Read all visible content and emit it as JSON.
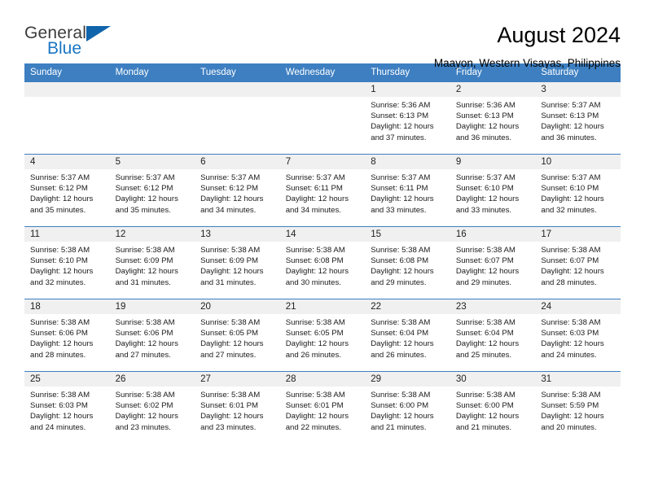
{
  "brand": {
    "line1": "General",
    "line2": "Blue",
    "triangle_color": "#1064ac",
    "blue_text_color": "#1b76c3"
  },
  "header": {
    "title": "August 2024",
    "subtitle": "Maayon, Western Visayas, Philippines"
  },
  "theme": {
    "header_row_bg": "#3d7fc1",
    "daynum_band_bg": "#f0f0f0",
    "row_divider": "#3d7fc1"
  },
  "calendar": {
    "weekday_headers": [
      "Sunday",
      "Monday",
      "Tuesday",
      "Wednesday",
      "Thursday",
      "Friday",
      "Saturday"
    ],
    "weeks": [
      [
        {
          "day": "",
          "sunrise": "",
          "sunset": "",
          "daylight": "",
          "daylight2": ""
        },
        {
          "day": "",
          "sunrise": "",
          "sunset": "",
          "daylight": "",
          "daylight2": ""
        },
        {
          "day": "",
          "sunrise": "",
          "sunset": "",
          "daylight": "",
          "daylight2": ""
        },
        {
          "day": "",
          "sunrise": "",
          "sunset": "",
          "daylight": "",
          "daylight2": ""
        },
        {
          "day": "1",
          "sunrise": "Sunrise: 5:36 AM",
          "sunset": "Sunset: 6:13 PM",
          "daylight": "Daylight: 12 hours",
          "daylight2": "and 37 minutes."
        },
        {
          "day": "2",
          "sunrise": "Sunrise: 5:36 AM",
          "sunset": "Sunset: 6:13 PM",
          "daylight": "Daylight: 12 hours",
          "daylight2": "and 36 minutes."
        },
        {
          "day": "3",
          "sunrise": "Sunrise: 5:37 AM",
          "sunset": "Sunset: 6:13 PM",
          "daylight": "Daylight: 12 hours",
          "daylight2": "and 36 minutes."
        }
      ],
      [
        {
          "day": "4",
          "sunrise": "Sunrise: 5:37 AM",
          "sunset": "Sunset: 6:12 PM",
          "daylight": "Daylight: 12 hours",
          "daylight2": "and 35 minutes."
        },
        {
          "day": "5",
          "sunrise": "Sunrise: 5:37 AM",
          "sunset": "Sunset: 6:12 PM",
          "daylight": "Daylight: 12 hours",
          "daylight2": "and 35 minutes."
        },
        {
          "day": "6",
          "sunrise": "Sunrise: 5:37 AM",
          "sunset": "Sunset: 6:12 PM",
          "daylight": "Daylight: 12 hours",
          "daylight2": "and 34 minutes."
        },
        {
          "day": "7",
          "sunrise": "Sunrise: 5:37 AM",
          "sunset": "Sunset: 6:11 PM",
          "daylight": "Daylight: 12 hours",
          "daylight2": "and 34 minutes."
        },
        {
          "day": "8",
          "sunrise": "Sunrise: 5:37 AM",
          "sunset": "Sunset: 6:11 PM",
          "daylight": "Daylight: 12 hours",
          "daylight2": "and 33 minutes."
        },
        {
          "day": "9",
          "sunrise": "Sunrise: 5:37 AM",
          "sunset": "Sunset: 6:10 PM",
          "daylight": "Daylight: 12 hours",
          "daylight2": "and 33 minutes."
        },
        {
          "day": "10",
          "sunrise": "Sunrise: 5:37 AM",
          "sunset": "Sunset: 6:10 PM",
          "daylight": "Daylight: 12 hours",
          "daylight2": "and 32 minutes."
        }
      ],
      [
        {
          "day": "11",
          "sunrise": "Sunrise: 5:38 AM",
          "sunset": "Sunset: 6:10 PM",
          "daylight": "Daylight: 12 hours",
          "daylight2": "and 32 minutes."
        },
        {
          "day": "12",
          "sunrise": "Sunrise: 5:38 AM",
          "sunset": "Sunset: 6:09 PM",
          "daylight": "Daylight: 12 hours",
          "daylight2": "and 31 minutes."
        },
        {
          "day": "13",
          "sunrise": "Sunrise: 5:38 AM",
          "sunset": "Sunset: 6:09 PM",
          "daylight": "Daylight: 12 hours",
          "daylight2": "and 31 minutes."
        },
        {
          "day": "14",
          "sunrise": "Sunrise: 5:38 AM",
          "sunset": "Sunset: 6:08 PM",
          "daylight": "Daylight: 12 hours",
          "daylight2": "and 30 minutes."
        },
        {
          "day": "15",
          "sunrise": "Sunrise: 5:38 AM",
          "sunset": "Sunset: 6:08 PM",
          "daylight": "Daylight: 12 hours",
          "daylight2": "and 29 minutes."
        },
        {
          "day": "16",
          "sunrise": "Sunrise: 5:38 AM",
          "sunset": "Sunset: 6:07 PM",
          "daylight": "Daylight: 12 hours",
          "daylight2": "and 29 minutes."
        },
        {
          "day": "17",
          "sunrise": "Sunrise: 5:38 AM",
          "sunset": "Sunset: 6:07 PM",
          "daylight": "Daylight: 12 hours",
          "daylight2": "and 28 minutes."
        }
      ],
      [
        {
          "day": "18",
          "sunrise": "Sunrise: 5:38 AM",
          "sunset": "Sunset: 6:06 PM",
          "daylight": "Daylight: 12 hours",
          "daylight2": "and 28 minutes."
        },
        {
          "day": "19",
          "sunrise": "Sunrise: 5:38 AM",
          "sunset": "Sunset: 6:06 PM",
          "daylight": "Daylight: 12 hours",
          "daylight2": "and 27 minutes."
        },
        {
          "day": "20",
          "sunrise": "Sunrise: 5:38 AM",
          "sunset": "Sunset: 6:05 PM",
          "daylight": "Daylight: 12 hours",
          "daylight2": "and 27 minutes."
        },
        {
          "day": "21",
          "sunrise": "Sunrise: 5:38 AM",
          "sunset": "Sunset: 6:05 PM",
          "daylight": "Daylight: 12 hours",
          "daylight2": "and 26 minutes."
        },
        {
          "day": "22",
          "sunrise": "Sunrise: 5:38 AM",
          "sunset": "Sunset: 6:04 PM",
          "daylight": "Daylight: 12 hours",
          "daylight2": "and 26 minutes."
        },
        {
          "day": "23",
          "sunrise": "Sunrise: 5:38 AM",
          "sunset": "Sunset: 6:04 PM",
          "daylight": "Daylight: 12 hours",
          "daylight2": "and 25 minutes."
        },
        {
          "day": "24",
          "sunrise": "Sunrise: 5:38 AM",
          "sunset": "Sunset: 6:03 PM",
          "daylight": "Daylight: 12 hours",
          "daylight2": "and 24 minutes."
        }
      ],
      [
        {
          "day": "25",
          "sunrise": "Sunrise: 5:38 AM",
          "sunset": "Sunset: 6:03 PM",
          "daylight": "Daylight: 12 hours",
          "daylight2": "and 24 minutes."
        },
        {
          "day": "26",
          "sunrise": "Sunrise: 5:38 AM",
          "sunset": "Sunset: 6:02 PM",
          "daylight": "Daylight: 12 hours",
          "daylight2": "and 23 minutes."
        },
        {
          "day": "27",
          "sunrise": "Sunrise: 5:38 AM",
          "sunset": "Sunset: 6:01 PM",
          "daylight": "Daylight: 12 hours",
          "daylight2": "and 23 minutes."
        },
        {
          "day": "28",
          "sunrise": "Sunrise: 5:38 AM",
          "sunset": "Sunset: 6:01 PM",
          "daylight": "Daylight: 12 hours",
          "daylight2": "and 22 minutes."
        },
        {
          "day": "29",
          "sunrise": "Sunrise: 5:38 AM",
          "sunset": "Sunset: 6:00 PM",
          "daylight": "Daylight: 12 hours",
          "daylight2": "and 21 minutes."
        },
        {
          "day": "30",
          "sunrise": "Sunrise: 5:38 AM",
          "sunset": "Sunset: 6:00 PM",
          "daylight": "Daylight: 12 hours",
          "daylight2": "and 21 minutes."
        },
        {
          "day": "31",
          "sunrise": "Sunrise: 5:38 AM",
          "sunset": "Sunset: 5:59 PM",
          "daylight": "Daylight: 12 hours",
          "daylight2": "and 20 minutes."
        }
      ]
    ]
  }
}
